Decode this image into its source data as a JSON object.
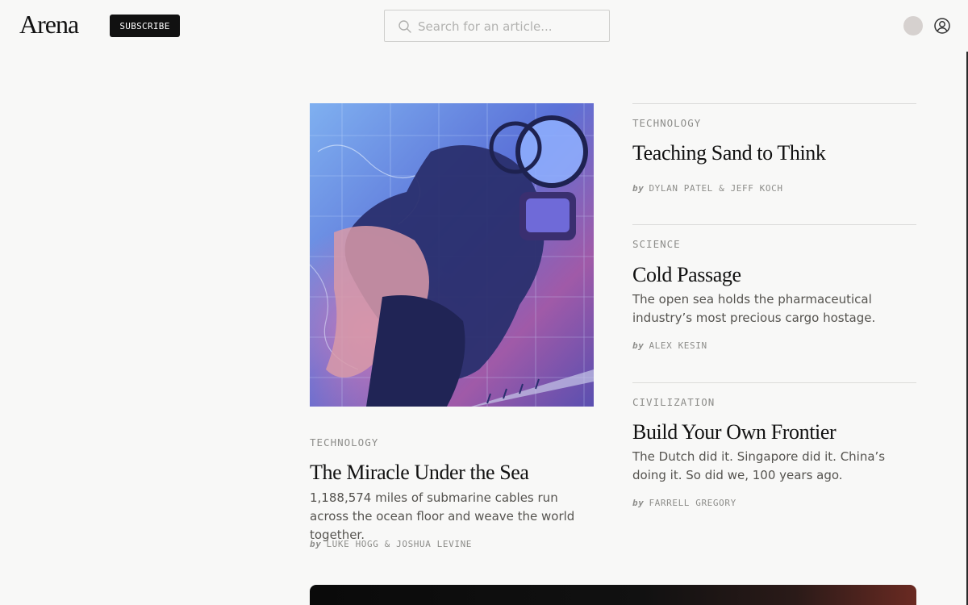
{
  "header": {
    "logo": "Arena",
    "subscribe_label": "SUBSCRIBE",
    "search_placeholder": "Search for an article..."
  },
  "lead": {
    "category": "TECHNOLOGY",
    "title": "The Miracle Under the Sea",
    "dek": "1,188,574 miles of submarine cables run across the ocean floor and weave the world together.",
    "by": "by",
    "authors": "LUKE HOGG & JOSHUA LEVINE"
  },
  "side": [
    {
      "category": "TECHNOLOGY",
      "title": "Teaching Sand to Think",
      "dek": "",
      "by": "by",
      "authors": "DYLAN PATEL & JEFF KOCH"
    },
    {
      "category": "SCIENCE",
      "title": "Cold Passage",
      "dek": "The open sea holds the pharmaceutical industry’s most precious cargo hostage.",
      "by": "by",
      "authors": "ALEX KESIN"
    },
    {
      "category": "CIVILIZATION",
      "title": "Build Your Own Frontier",
      "dek": "The Dutch did it. Singapore did it. China’s doing it. So did we, 100 years ago.",
      "by": "by",
      "authors": "FARRELL GREGORY"
    }
  ]
}
